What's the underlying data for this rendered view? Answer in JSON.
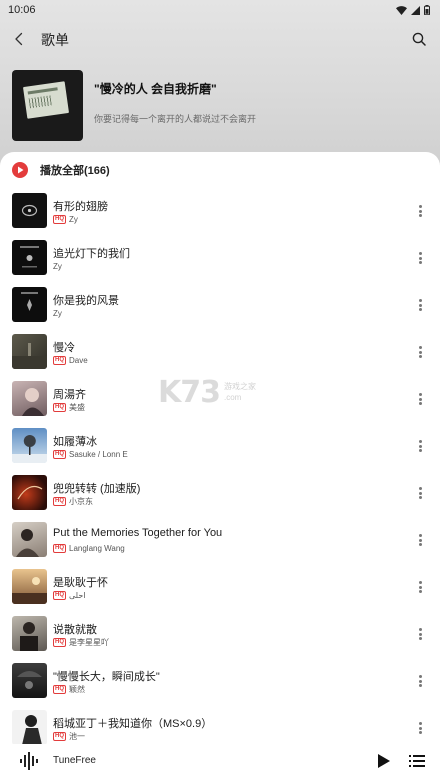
{
  "status_bar": {
    "time": "10:06"
  },
  "header": {
    "title": "歌单"
  },
  "playlist": {
    "title": "\"慢冷的人 会自我折磨\"",
    "description": "你要记得每一个离开的人都说过不会离开"
  },
  "play_all": {
    "label": "播放全部(166)"
  },
  "songs": [
    {
      "title": "有形的翅膀",
      "artist": "Zy",
      "hq": true
    },
    {
      "title": "追光灯下的我们",
      "artist": "Zy",
      "hq": false
    },
    {
      "title": "你是我的风景",
      "artist": "Zy",
      "hq": false
    },
    {
      "title": "慢冷",
      "artist": "Dave",
      "hq": true
    },
    {
      "title": "周湯齐",
      "artist": "美盛",
      "hq": true
    },
    {
      "title": "如履薄冰",
      "artist": "Sasuke / Lonn E",
      "hq": true
    },
    {
      "title": "兜兜转转 (加速版)",
      "artist": "小京东",
      "hq": true
    },
    {
      "title": "Put the Memories Together for You",
      "artist": "Langlang Wang",
      "hq": true
    },
    {
      "title": "是耿耿于怀",
      "artist": "احلى",
      "hq": true
    },
    {
      "title": "说散就散",
      "artist": "是李星星吖",
      "hq": true
    },
    {
      "title": "\"慢慢长大，瞬间成长\"",
      "artist": "颖然",
      "hq": true
    },
    {
      "title": "稻城亚丁＋我知道你（MS×0.9）",
      "artist": "池一",
      "hq": true
    }
  ],
  "hq_label": "HQ",
  "watermark": {
    "main": "K73",
    "line1": "游戏之家",
    "line2": ".com"
  },
  "mini_player": {
    "name": "TuneFree"
  },
  "colors": {
    "accent": "#e33c3c",
    "header_bg": "#dcdcdc"
  },
  "icons": {
    "back": "chevron-left-icon",
    "search": "search-icon",
    "play_all": "play-circle-icon",
    "more": "more-vertical-icon",
    "play": "play-icon",
    "playlist": "playlist-icon",
    "waveform": "waveform-icon"
  }
}
